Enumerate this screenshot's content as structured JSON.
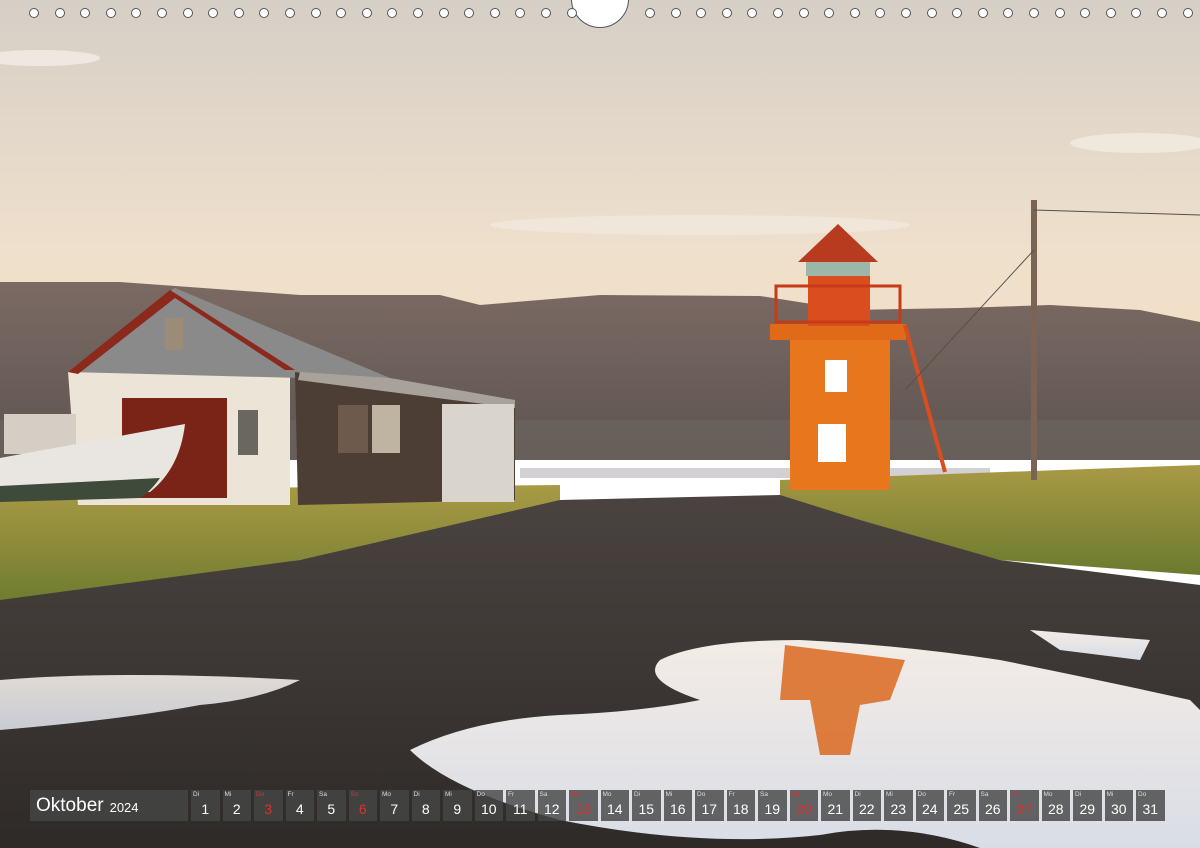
{
  "calendar": {
    "month": "Oktober",
    "year": "2024",
    "holiday_color": "#e0302a",
    "days": [
      {
        "wd": "Di",
        "n": "1",
        "red": false
      },
      {
        "wd": "Mi",
        "n": "2",
        "red": false
      },
      {
        "wd": "Do",
        "n": "3",
        "red": true
      },
      {
        "wd": "Fr",
        "n": "4",
        "red": false
      },
      {
        "wd": "Sa",
        "n": "5",
        "red": false
      },
      {
        "wd": "So",
        "n": "6",
        "red": true
      },
      {
        "wd": "Mo",
        "n": "7",
        "red": false
      },
      {
        "wd": "Di",
        "n": "8",
        "red": false
      },
      {
        "wd": "Mi",
        "n": "9",
        "red": false
      },
      {
        "wd": "Do",
        "n": "10",
        "red": false
      },
      {
        "wd": "Fr",
        "n": "11",
        "red": false
      },
      {
        "wd": "Sa",
        "n": "12",
        "red": false
      },
      {
        "wd": "So",
        "n": "13",
        "red": true
      },
      {
        "wd": "Mo",
        "n": "14",
        "red": false
      },
      {
        "wd": "Di",
        "n": "15",
        "red": false
      },
      {
        "wd": "Mi",
        "n": "16",
        "red": false
      },
      {
        "wd": "Do",
        "n": "17",
        "red": false
      },
      {
        "wd": "Fr",
        "n": "18",
        "red": false
      },
      {
        "wd": "Sa",
        "n": "19",
        "red": false
      },
      {
        "wd": "So",
        "n": "20",
        "red": true
      },
      {
        "wd": "Mo",
        "n": "21",
        "red": false
      },
      {
        "wd": "Di",
        "n": "22",
        "red": false
      },
      {
        "wd": "Mi",
        "n": "23",
        "red": false
      },
      {
        "wd": "Do",
        "n": "24",
        "red": false
      },
      {
        "wd": "Fr",
        "n": "25",
        "red": false
      },
      {
        "wd": "Sa",
        "n": "26",
        "red": false
      },
      {
        "wd": "So",
        "n": "27",
        "red": true
      },
      {
        "wd": "Mo",
        "n": "28",
        "red": false
      },
      {
        "wd": "Di",
        "n": "29",
        "red": false
      },
      {
        "wd": "Mi",
        "n": "30",
        "red": false
      },
      {
        "wd": "Do",
        "n": "31",
        "red": false
      }
    ]
  },
  "photo": {
    "subject": "orange lighthouse beside wooden sheds and a boat, puddle reflection, mountains at sunset",
    "colors": {
      "lighthouse": "#e8761c",
      "roof": "#b83a1f",
      "sky_top": "#d9d2c8",
      "sky_bottom": "#f3dcc0"
    }
  }
}
